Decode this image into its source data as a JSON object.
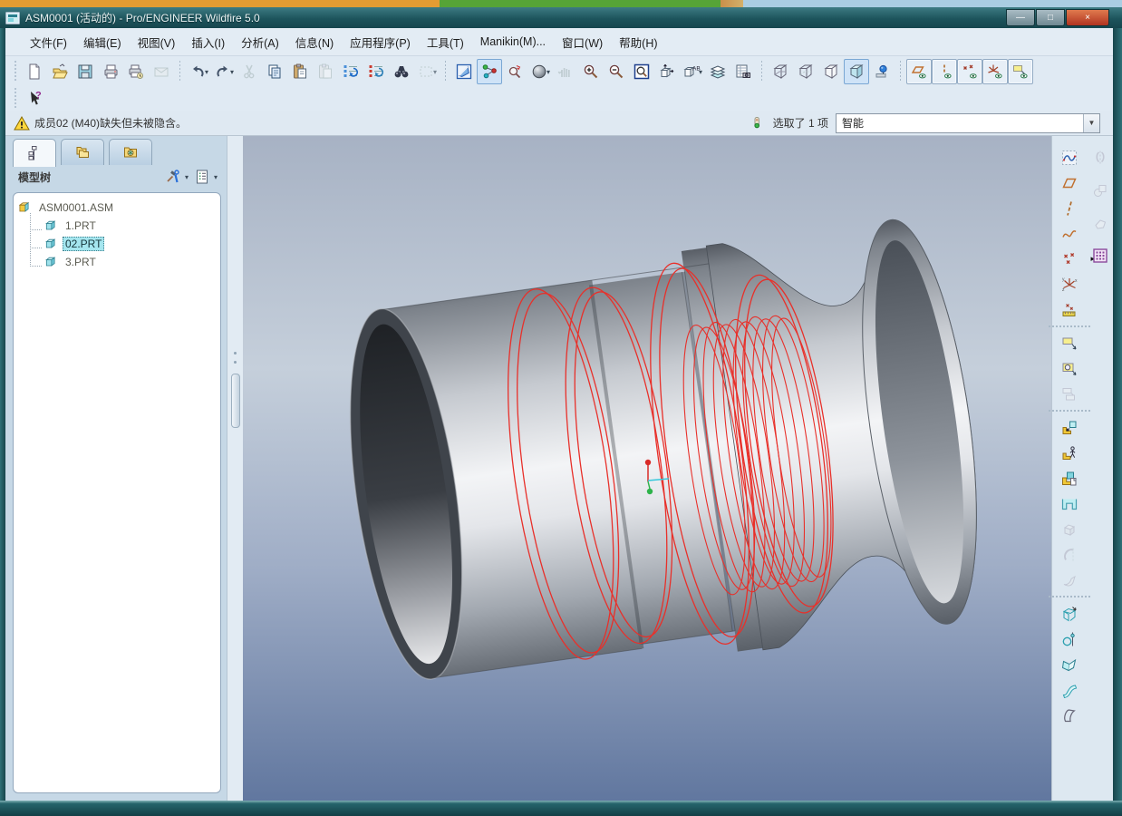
{
  "window": {
    "title": "ASM0001 (活动的) - Pro/ENGINEER Wildfire 5.0",
    "controls": {
      "minimize": "—",
      "maximize": "□",
      "close": "×"
    }
  },
  "menubar": {
    "items": [
      {
        "name": "menu-file",
        "label": "文件(F)"
      },
      {
        "name": "menu-edit",
        "label": "编辑(E)"
      },
      {
        "name": "menu-view",
        "label": "视图(V)"
      },
      {
        "name": "menu-insert",
        "label": "插入(I)"
      },
      {
        "name": "menu-analysis",
        "label": "分析(A)"
      },
      {
        "name": "menu-info",
        "label": "信息(N)"
      },
      {
        "name": "menu-applications",
        "label": "应用程序(P)"
      },
      {
        "name": "menu-tools",
        "label": "工具(T)"
      },
      {
        "name": "menu-manikin",
        "label": "Manikin(M)..."
      },
      {
        "name": "menu-window",
        "label": "窗口(W)"
      },
      {
        "name": "menu-help",
        "label": "帮助(H)"
      }
    ]
  },
  "toolbar_main": {
    "items": [
      {
        "name": "new-file-button",
        "glyph": "new"
      },
      {
        "name": "open-file-button",
        "glyph": "open"
      },
      {
        "name": "save-button",
        "glyph": "save"
      },
      {
        "name": "print-button",
        "glyph": "print"
      },
      {
        "name": "print-setup-button",
        "glyph": "print2"
      },
      {
        "name": "send-email-button",
        "glyph": "mail",
        "state": "disabled"
      },
      {
        "sep": true
      },
      {
        "name": "undo-button",
        "glyph": "undo",
        "flyout": "down"
      },
      {
        "name": "redo-button",
        "glyph": "redo",
        "flyout": "down"
      },
      {
        "name": "cut-button",
        "glyph": "cut",
        "state": "disabled"
      },
      {
        "name": "copy-button",
        "glyph": "copy"
      },
      {
        "name": "paste-button",
        "glyph": "paste"
      },
      {
        "name": "paste-special-button",
        "glyph": "paste2",
        "state": "disabled"
      },
      {
        "name": "regenerate-button",
        "glyph": "regen1"
      },
      {
        "name": "regenerate-manager-button",
        "glyph": "regen2"
      },
      {
        "name": "find-button",
        "glyph": "find"
      },
      {
        "name": "select-by-box-button",
        "glyph": "selbox",
        "state": "disabled",
        "flyout": "down"
      },
      {
        "sep": true
      },
      {
        "name": "repaint-button",
        "glyph": "repaint"
      },
      {
        "name": "spin-center-toggle",
        "glyph": "spincenter",
        "state": "active"
      },
      {
        "name": "orient-mode-button",
        "glyph": "orient"
      },
      {
        "name": "render-style-button",
        "glyph": "sphere",
        "flyout": "down"
      },
      {
        "name": "pan-zoom-button",
        "glyph": "hand",
        "state": "disabled"
      },
      {
        "name": "zoom-in-button",
        "glyph": "zoomin"
      },
      {
        "name": "zoom-out-button",
        "glyph": "zoomout"
      },
      {
        "name": "refit-button",
        "glyph": "refit"
      },
      {
        "name": "reorient-button",
        "glyph": "reorient"
      },
      {
        "name": "saved-views-button",
        "glyph": "views",
        "flyout": "down"
      },
      {
        "name": "layers-button",
        "glyph": "layers"
      },
      {
        "name": "view-manager-button",
        "glyph": "viewmgr"
      },
      {
        "sep": true
      },
      {
        "name": "wireframe-button",
        "glyph": "cubewire"
      },
      {
        "name": "hidden-line-button",
        "glyph": "cubehid"
      },
      {
        "name": "no-hidden-button",
        "glyph": "cubenohid"
      },
      {
        "name": "shaded-button",
        "glyph": "cubeshade",
        "state": "active"
      },
      {
        "name": "enhanced-realism-button",
        "glyph": "realism"
      },
      {
        "sep": true
      },
      {
        "name": "datum-plane-display-toggle",
        "glyph": "tglplane",
        "state": "toggle"
      },
      {
        "name": "datum-axis-display-toggle",
        "glyph": "tglaxis",
        "state": "toggle"
      },
      {
        "name": "datum-point-display-toggle",
        "glyph": "tglpoint",
        "state": "toggle"
      },
      {
        "name": "csys-display-toggle",
        "glyph": "tglcsys",
        "state": "toggle"
      },
      {
        "name": "annotation-display-toggle",
        "glyph": "tglnote",
        "state": "toggle"
      }
    ]
  },
  "toolbar_second": {
    "items": [
      {
        "name": "select-items-button",
        "glyph": "selarrow"
      }
    ]
  },
  "message_bar": {
    "text": "成员02 (M40)缺失但未被隐含。"
  },
  "status_bar": {
    "selected_prefix": "选取了",
    "selected_count": "1",
    "selected_unit": "项",
    "filter_value": "智能"
  },
  "navigator": {
    "tabs": [
      {
        "name": "tab-model-tree",
        "glyph": "tabtree",
        "selected": true
      },
      {
        "name": "tab-folder-browser",
        "glyph": "tabfolders"
      },
      {
        "name": "tab-favorites",
        "glyph": "tabfav"
      }
    ],
    "header": {
      "title": "模型树"
    },
    "tree": [
      {
        "label": "ASM0001.ASM",
        "icon": "asm",
        "level": 0
      },
      {
        "label": "1.PRT",
        "icon": "part",
        "level": 1
      },
      {
        "label": "02.PRT",
        "icon": "part",
        "level": 1,
        "selected": true
      },
      {
        "label": "3.PRT",
        "icon": "part",
        "level": 1
      }
    ]
  },
  "right_toolbar": {
    "column1": [
      {
        "name": "style-tool-button",
        "glyph": "rstyle"
      },
      {
        "name": "datum-plane-button",
        "glyph": "rplane"
      },
      {
        "name": "datum-axis-button",
        "glyph": "raxis"
      },
      {
        "name": "datum-curve-button",
        "glyph": "rcurve"
      },
      {
        "name": "datum-point-button",
        "glyph": "rpoint",
        "flyout": "right"
      },
      {
        "name": "datum-csys-button",
        "glyph": "rcsys"
      },
      {
        "name": "datum-target-button",
        "glyph": "rruler"
      },
      {
        "sep": true
      },
      {
        "name": "annotation-button",
        "glyph": "rnote"
      },
      {
        "name": "annotation-feature-button",
        "glyph": "rnote2"
      },
      {
        "name": "annotation-group-button",
        "glyph": "rnote3",
        "state": "disabled"
      },
      {
        "sep": true
      },
      {
        "name": "assemble-component-button",
        "glyph": "rassem"
      },
      {
        "name": "assemble-manikin-button",
        "glyph": "rmanikin"
      },
      {
        "name": "create-component-button",
        "glyph": "rcreate"
      },
      {
        "name": "slot-feature-button",
        "glyph": "rslot"
      },
      {
        "name": "extrude-button",
        "glyph": "rextg",
        "state": "disabled"
      },
      {
        "name": "revolve-button",
        "glyph": "rrevg",
        "state": "disabled"
      },
      {
        "name": "sweep-button",
        "glyph": "rswpg",
        "state": "disabled"
      },
      {
        "sep": true
      },
      {
        "name": "datum-box-button",
        "glyph": "rbox"
      },
      {
        "name": "revolve-surface-button",
        "glyph": "rrev"
      },
      {
        "name": "plane-normal-button",
        "glyph": "rarr"
      },
      {
        "name": "boundary-blend-button",
        "glyph": "rblend"
      },
      {
        "name": "style-surface-button",
        "glyph": "rband"
      }
    ],
    "column2": [
      {
        "name": "mirror-button",
        "glyph": "c2mirror",
        "state": "disabled"
      },
      {
        "name": "merge-button",
        "glyph": "c2merge",
        "state": "disabled"
      },
      {
        "name": "inheritance-button",
        "glyph": "c2inherit",
        "state": "disabled"
      },
      {
        "name": "pattern-button",
        "glyph": "c2pattern"
      }
    ]
  },
  "viewport": {
    "highlight_color": "#e8302a",
    "background_top": "#a7b2c4",
    "background_bottom": "#61779f",
    "model_gray_light": "#f3f4f6",
    "model_gray_dark": "#51565e"
  }
}
